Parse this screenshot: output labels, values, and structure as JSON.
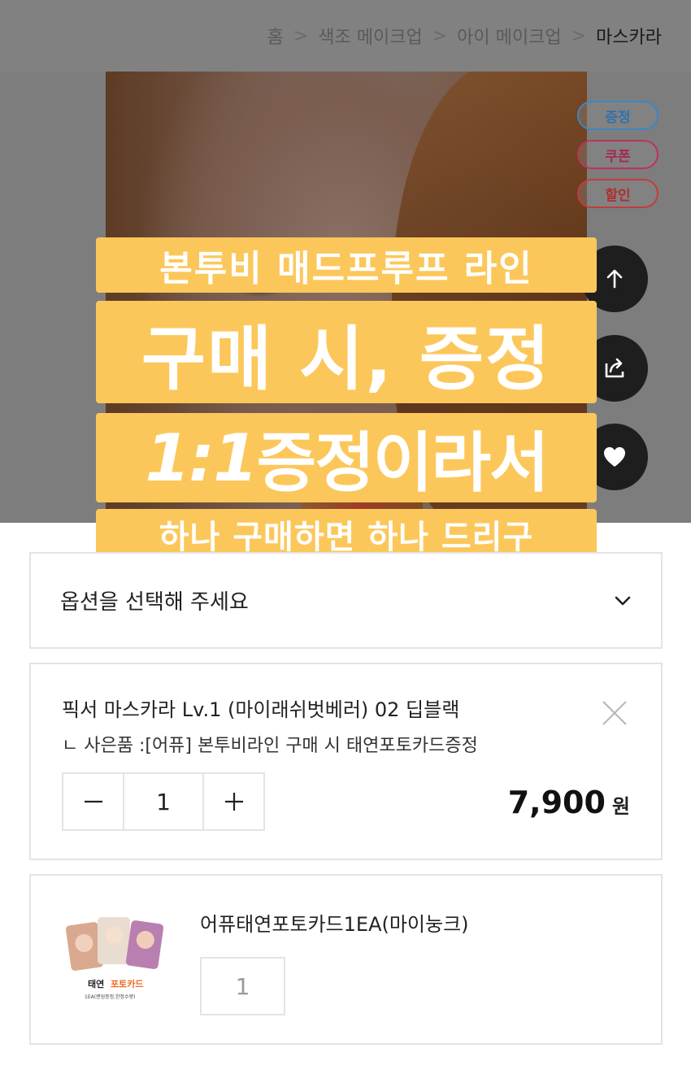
{
  "breadcrumb": {
    "items": [
      "홈",
      "색조 메이크업",
      "아이 메이크업",
      "마스카라"
    ]
  },
  "badges": {
    "gift": "증정",
    "coupon": "쿠폰",
    "sale": "할인"
  },
  "fabs": {
    "icons": [
      "arrow-up-icon",
      "share-icon",
      "heart-icon"
    ]
  },
  "captions": {
    "line1": "본투비 매드프루프 라인",
    "line2": "구매 시, 증정",
    "line3_italic": "1:1",
    "line3_rest": "증정이라서",
    "line4": "하나 구매하면 하나 드리구"
  },
  "option": {
    "placeholder": "옵션을 선택해 주세요"
  },
  "selected_item": {
    "name": "픽서 마스카라 Lv.1 (마이래쉬벗베러) 02 딥블랙",
    "gift_line": "ㄴ 사은품 :[어퓨] 본투비라인 구매 시 태연포토카드증정",
    "quantity": "1",
    "price": "7,900",
    "currency": "원"
  },
  "gift_item": {
    "name": "어퓨태연포토카드1EA(마이눙크)",
    "quantity": "1",
    "thumb_title_black": "태연",
    "thumb_title_orange": "포토카드",
    "thumb_subtitle": "1EA(랜덤증정,한정수량)"
  },
  "colors": {
    "caption_bg": "#fcc75a",
    "gift_badge": "#3d86c6",
    "coupon_badge": "#c2305c",
    "sale_badge": "#c63b3b"
  }
}
